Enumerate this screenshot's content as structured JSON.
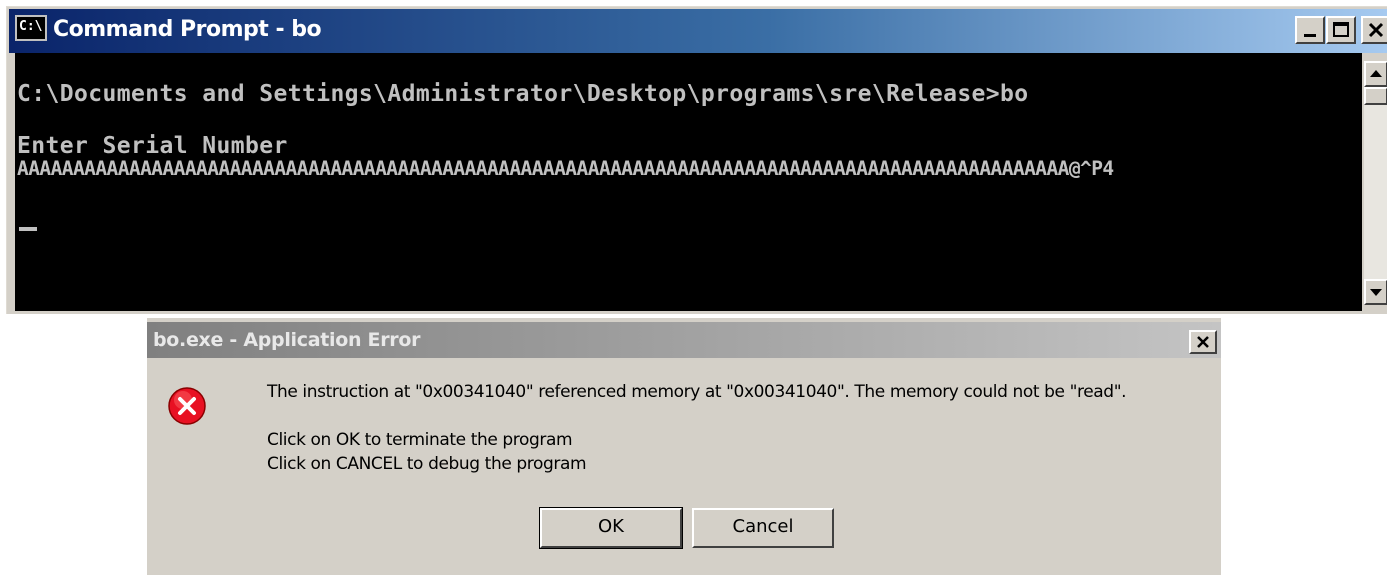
{
  "cmd": {
    "title": "Command Prompt - bo",
    "icon": "cmd-icon",
    "icon_glyph": "C:\\",
    "lines": {
      "path": "C:\\Documents and Settings\\Administrator\\Desktop\\programs\\sre\\Release>bo",
      "enter": "Enter Serial Number",
      "serial": "AAAAAAAAAAAAAAAAAAAAAAAAAAAAAAAAAAAAAAAAAAAAAAAAAAAAAAAAAAAAAAAAAAAAAAAAAAAAAAAAAAAAAAAAAAAAAA@^P4"
    }
  },
  "dialog": {
    "title": "bo.exe - Application Error",
    "close_glyph": "×",
    "message": "The instruction at \"0x00341040\" referenced memory at \"0x00341040\". The memory could not be \"read\".",
    "ok_hint": "Click on OK to terminate the program",
    "cancel_hint": "Click on CANCEL to debug the program",
    "ok_label": "OK",
    "cancel_label": "Cancel"
  },
  "colors": {
    "console_bg": "#000000",
    "console_text": "#c0c0c0",
    "active_title": "#0a246a",
    "error_red": "#e81123"
  }
}
